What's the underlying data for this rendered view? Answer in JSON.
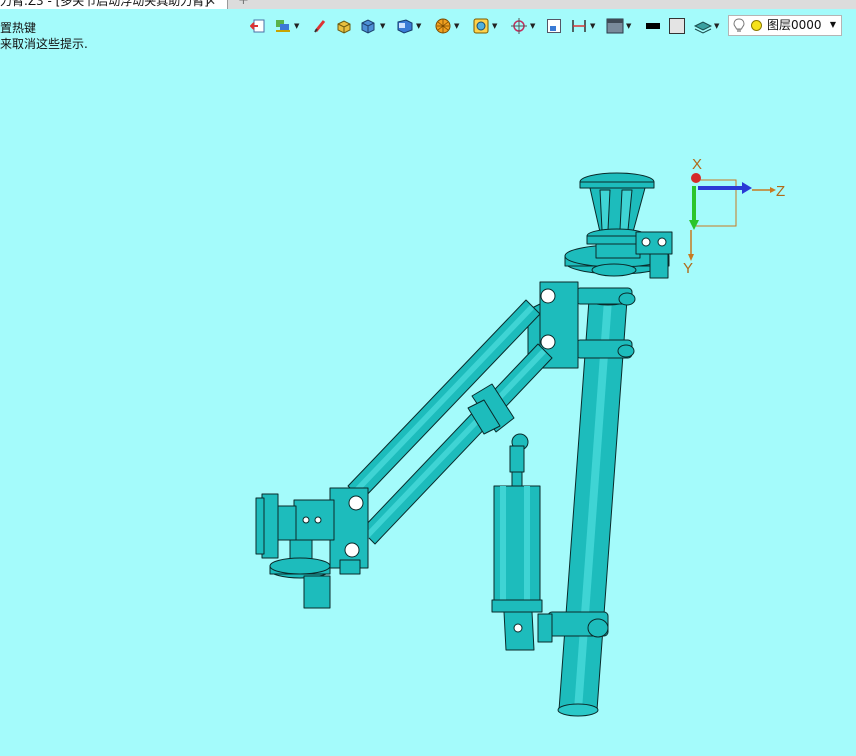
{
  "tab": {
    "title": "力臂.Z3 - [多关节启动浮动夹具助力臂]",
    "close_glyph": "✕",
    "add_glyph": "+"
  },
  "hints": {
    "line1": "置热键",
    "line2": "来取消这些提示."
  },
  "toolbar": {
    "icons": [
      "exit-sketch-icon",
      "layers-toggle-icon",
      "pencil-icon",
      "solid-box-icon",
      "shaded-cube-icon",
      "view-cube-icon",
      "render-mode-icon",
      "wireframe-mode-icon",
      "orient-axes-icon",
      "frame-icon",
      "dimension-icon",
      "display-panel-icon",
      "line-color-swatch",
      "fill-color-swatch",
      "layer-stack-icon"
    ],
    "layer_name": "图层0000"
  },
  "triad": {
    "x_label": "X",
    "y_label": "Y",
    "z_label": "Z"
  },
  "colors": {
    "background": "#a4fbfb",
    "model_fill": "#1dbcbc",
    "model_edge": "#0a2a2a",
    "axis_label": "#b06a1a"
  }
}
